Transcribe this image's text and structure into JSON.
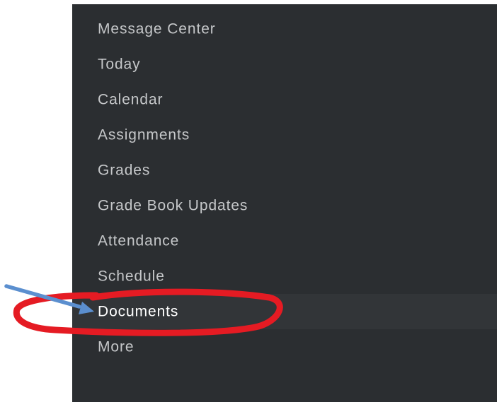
{
  "sidebar": {
    "items": [
      {
        "label": "Message Center",
        "active": false
      },
      {
        "label": "Today",
        "active": false
      },
      {
        "label": "Calendar",
        "active": false
      },
      {
        "label": "Assignments",
        "active": false
      },
      {
        "label": "Grades",
        "active": false
      },
      {
        "label": "Grade Book Updates",
        "active": false
      },
      {
        "label": "Attendance",
        "active": false
      },
      {
        "label": "Schedule",
        "active": false
      },
      {
        "label": "Documents",
        "active": true
      },
      {
        "label": "More",
        "active": false
      }
    ]
  },
  "annotation": {
    "highlight_color": "#e51b23",
    "arrow_color": "#5b8fcf",
    "target": "Documents"
  }
}
